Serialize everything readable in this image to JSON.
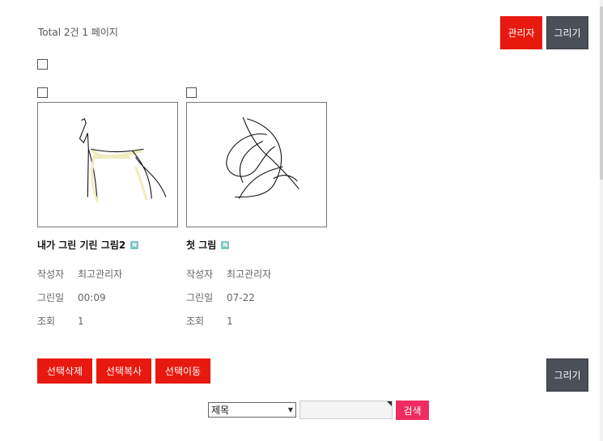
{
  "list": {
    "total_text": "Total 2건 1 페이지"
  },
  "toolbar": {
    "admin_label": "관리자",
    "draw_label": "그리기"
  },
  "cards": [
    {
      "title": "내가 그린 기린 그림2",
      "new_badge": "N",
      "author_label": "작성자",
      "author": "최고관리자",
      "date_label": "그린일",
      "date": "00:09",
      "views_label": "조회",
      "views": "1"
    },
    {
      "title": "첫 그림",
      "new_badge": "N",
      "author_label": "작성자",
      "author": "최고관리자",
      "date_label": "그린일",
      "date": "07-22",
      "views_label": "조회",
      "views": "1"
    }
  ],
  "actions": {
    "delete_label": "선택삭제",
    "copy_label": "선택복사",
    "move_label": "선택이동",
    "draw_label": "그리기"
  },
  "search": {
    "field_selected": "제목",
    "query": "",
    "button_label": "검색"
  },
  "colors": {
    "red": "#e8190f",
    "dark": "#4b5058",
    "pink": "#ef2b5f"
  }
}
